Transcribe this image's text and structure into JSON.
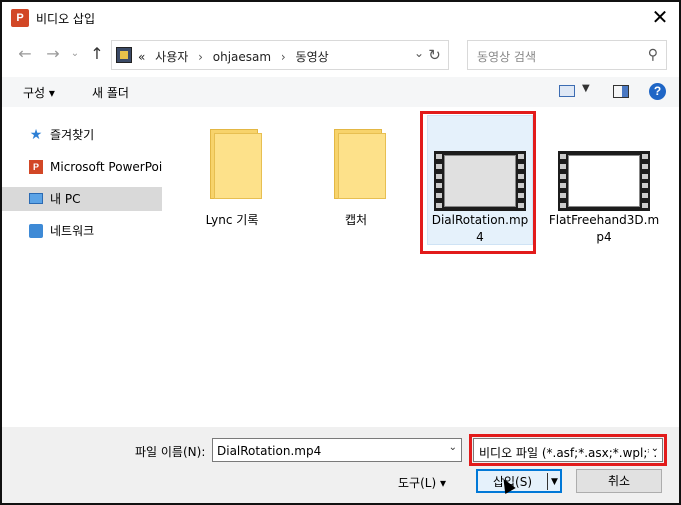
{
  "window": {
    "title": "비디오 삽입",
    "app_icon": "P"
  },
  "nav": {
    "crumbs_prefix": "«",
    "crumbs": [
      "사용자",
      "ohjaesam",
      "동영상"
    ],
    "crumb_sep": "›",
    "search_placeholder": "동영상 검색"
  },
  "toolbar": {
    "organize": "구성 ▾",
    "new_folder": "새 폴더"
  },
  "sidebar": {
    "items": [
      {
        "label": "즐겨찾기",
        "icon": "star-icon"
      },
      {
        "label": "Microsoft PowerPoint",
        "icon": "powerpoint-icon"
      },
      {
        "label": "내 PC",
        "icon": "computer-icon",
        "selected": true
      },
      {
        "label": "네트워크",
        "icon": "network-icon"
      }
    ]
  },
  "files": [
    {
      "label": "Lync 기록",
      "type": "folder"
    },
    {
      "label": "캡처",
      "type": "folder"
    },
    {
      "label": "DialRotation.mp4",
      "type": "video",
      "selected": true
    },
    {
      "label": "FlatFreehand3D.mp4",
      "type": "video"
    }
  ],
  "bottom": {
    "filename_label": "파일 이름(N):",
    "filename_value": "DialRotation.mp4",
    "filetype_value": "비디오 파일 (*.asf;*.asx;*.wpl;*.",
    "tools_label": "도구(L) ▾",
    "insert_label": "삽입(S)",
    "cancel_label": "취소"
  },
  "colors": {
    "highlight": "#e21b1b",
    "accent": "#0078d7"
  }
}
